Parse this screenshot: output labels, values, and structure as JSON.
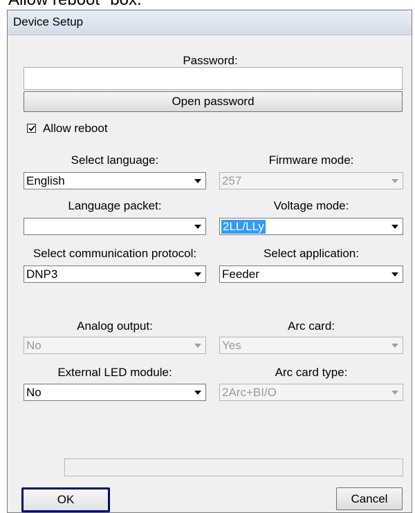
{
  "caption": "Allow reboot\" box.",
  "dialog": {
    "title": "Device Setup"
  },
  "password": {
    "label": "Password:",
    "value": "",
    "open_button": "Open password"
  },
  "allow_reboot": {
    "label": "Allow reboot",
    "checked": true
  },
  "fields": {
    "select_language": {
      "label": "Select language:",
      "value": "English",
      "enabled": true
    },
    "firmware_mode": {
      "label": "Firmware mode:",
      "value": "257",
      "enabled": false
    },
    "language_packet": {
      "label": "Language packet:",
      "value": "",
      "enabled": true
    },
    "voltage_mode": {
      "label": "Voltage mode:",
      "value": "2LL/LLy",
      "enabled": true,
      "selected_text": true
    },
    "communication_protocol": {
      "label": "Select communication protocol:",
      "value": "DNP3",
      "enabled": true
    },
    "select_application": {
      "label": "Select application:",
      "value": "Feeder",
      "enabled": true
    },
    "analog_output": {
      "label": "Analog output:",
      "value": "No",
      "enabled": false
    },
    "arc_card": {
      "label": "Arc card:",
      "value": "Yes",
      "enabled": false
    },
    "external_led_module": {
      "label": "External LED module:",
      "value": "No",
      "enabled": true
    },
    "arc_card_type": {
      "label": "Arc card type:",
      "value": "2Arc+BI/O",
      "enabled": false
    }
  },
  "buttons": {
    "ok": "OK",
    "cancel": "Cancel"
  },
  "colors": {
    "selection": "#3399ff",
    "focus_border": "#000a7a",
    "dialog_bg": "#f0f0f0"
  },
  "icons": {
    "dropdown": "chevron-down-icon",
    "check": "checkmark-icon"
  }
}
